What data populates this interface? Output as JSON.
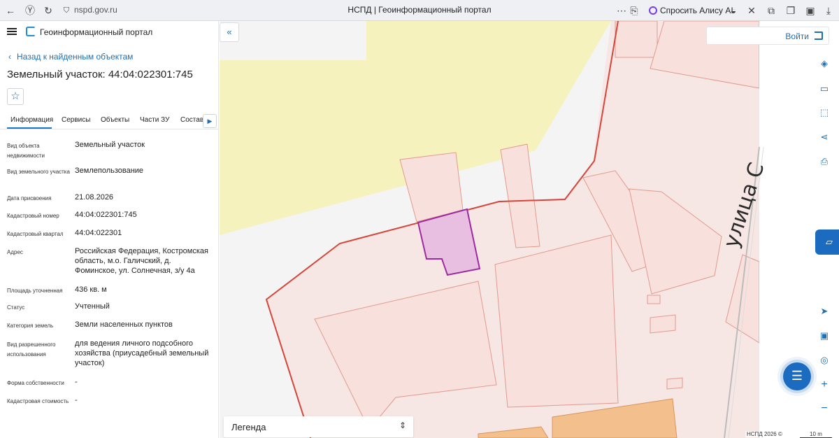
{
  "browser": {
    "url": "nspd.gov.ru",
    "page_title": "НСПД | Геоинформационный портал",
    "alice_label": "Спросить Алису AI"
  },
  "sidebar": {
    "portal_title": "Геоинформационный портал",
    "back_link": "Назад к найденным объектам",
    "object_title": "Земельный участок: 44:04:022301:745",
    "tabs": [
      "Информация",
      "Сервисы",
      "Объекты",
      "Части ЗУ",
      "Состав"
    ],
    "properties": [
      {
        "label": "Вид объекта недвижимости",
        "value": "Земельный участок"
      },
      {
        "label": "Вид земельного участка",
        "value": "Землепользование"
      },
      {
        "label": "Дата присвоения",
        "value": "21.08.2026"
      },
      {
        "label": "Кадастровый номер",
        "value": "44:04:022301:745"
      },
      {
        "label": "Кадастровый квартал",
        "value": "44:04:022301"
      },
      {
        "label": "Адрес",
        "value": "Российская Федерация, Костромская область, м.о. Галичский, д. Фоминское, ул. Солнечная, з/у 4а"
      },
      {
        "label": "Площадь уточненная",
        "value": "436 кв. м"
      },
      {
        "label": "Статус",
        "value": "Учтенный"
      },
      {
        "label": "Категория земель",
        "value": "Земли населенных пунктов"
      },
      {
        "label": "Вид разрешенного использования",
        "value": "для ведения личного подсобного хозяйства (приусадебный земельный участок)"
      },
      {
        "label": "Форма собственности",
        "value": "-"
      },
      {
        "label": "Кадастровая стоимость",
        "value": "-"
      }
    ]
  },
  "map": {
    "login_label": "Войти",
    "street_label": "улица С",
    "legend_label": "Легенда",
    "attribution": "НСПД 2026 ©",
    "scale_label": "10 m",
    "colors": {
      "yellow_zone": "#f6f2bd",
      "parcel_fill": "#f8e0dd",
      "parcel_stroke": "#e2998e",
      "boundary": "#d6453a",
      "selected_fill": "#e8bfe0",
      "selected_stroke": "#9d2ba0",
      "building_fill": "#f3bf8d",
      "accent": "#1b6cc1"
    }
  }
}
